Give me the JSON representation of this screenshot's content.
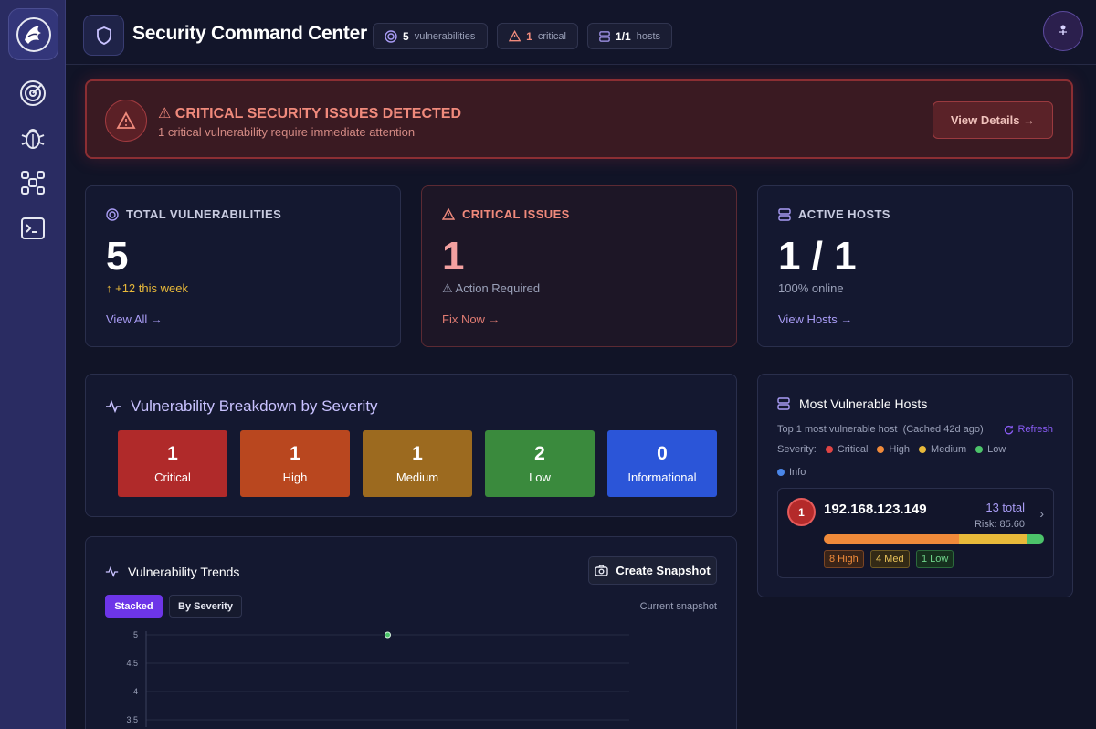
{
  "header": {
    "title": "Security Command Center",
    "pills": [
      {
        "value": "5",
        "label": "vulnerabilities"
      },
      {
        "value": "1",
        "label": "critical"
      },
      {
        "value": "1/1",
        "label": "hosts"
      }
    ]
  },
  "sidebar": {
    "items": [
      {
        "icon": "radar-icon"
      },
      {
        "icon": "bug-icon"
      },
      {
        "icon": "network-icon"
      },
      {
        "icon": "terminal-icon"
      }
    ]
  },
  "alert": {
    "title": "⚠ CRITICAL SECURITY ISSUES DETECTED",
    "subtitle": "1 critical vulnerability require immediate attention",
    "button": "View Details →"
  },
  "stats": {
    "total": {
      "label": "TOTAL VULNERABILITIES",
      "value": "5",
      "sub": "↑ +12 this week",
      "link": "View All →"
    },
    "critical": {
      "label": "CRITICAL ISSUES",
      "value": "1",
      "sub": "⚠ Action Required",
      "link": "Fix Now →"
    },
    "hosts": {
      "label": "ACTIVE HOSTS",
      "value": "1 / 1",
      "sub": "100% online",
      "link": "View Hosts →"
    }
  },
  "breakdown": {
    "title": "Vulnerability Breakdown by Severity",
    "items": [
      {
        "count": "1",
        "label": "Critical",
        "color": "#b02a2a"
      },
      {
        "count": "1",
        "label": "High",
        "color": "#b9471f"
      },
      {
        "count": "1",
        "label": "Medium",
        "color": "#9c6a1f"
      },
      {
        "count": "2",
        "label": "Low",
        "color": "#3a8a3d"
      },
      {
        "count": "0",
        "label": "Informational",
        "color": "#2b55d8"
      }
    ]
  },
  "vulnerable_hosts": {
    "title": "Most Vulnerable Hosts",
    "meta": "Top 1 most vulnerable host  (Cached 42d ago)",
    "refresh": "Refresh",
    "legend_label": "Severity:",
    "legend": [
      {
        "label": "Critical",
        "color": "#e04444"
      },
      {
        "label": "High",
        "color": "#f08a3a"
      },
      {
        "label": "Medium",
        "color": "#e8b93a"
      },
      {
        "label": "Low",
        "color": "#4cc36a"
      },
      {
        "label": "Info",
        "color": "#4a86e8"
      }
    ],
    "host": {
      "rank": "1",
      "ip": "192.168.123.149",
      "total": "13 total",
      "risk": "Risk: 85.60",
      "bar": [
        {
          "fraction": 8,
          "color": "#f08a3a"
        },
        {
          "fraction": 4,
          "color": "#e8b93a"
        },
        {
          "fraction": 1,
          "color": "#4cc36a"
        }
      ],
      "tags": [
        {
          "text": "8 High",
          "color": "#f08a3a",
          "bg": "#3a2418",
          "border": "#7a4524"
        },
        {
          "text": "4 Med",
          "color": "#e8c25a",
          "bg": "#332a16",
          "border": "#6e5a24"
        },
        {
          "text": "1 Low",
          "color": "#6fd38a",
          "bg": "#16301e",
          "border": "#2c6a3c"
        }
      ]
    }
  },
  "trends": {
    "title": "Vulnerability Trends",
    "snapshot_button": "Create Snapshot",
    "toggle_stacked": "Stacked",
    "toggle_severity": "By Severity",
    "current": "Current snapshot"
  },
  "chart_data": {
    "type": "line",
    "y_ticks": [
      "5",
      "4.5",
      "4",
      "3.5"
    ],
    "ylim": [
      3.5,
      5
    ],
    "series": [
      {
        "values": [
          5
        ]
      }
    ],
    "point_color": "#4cc36a"
  }
}
